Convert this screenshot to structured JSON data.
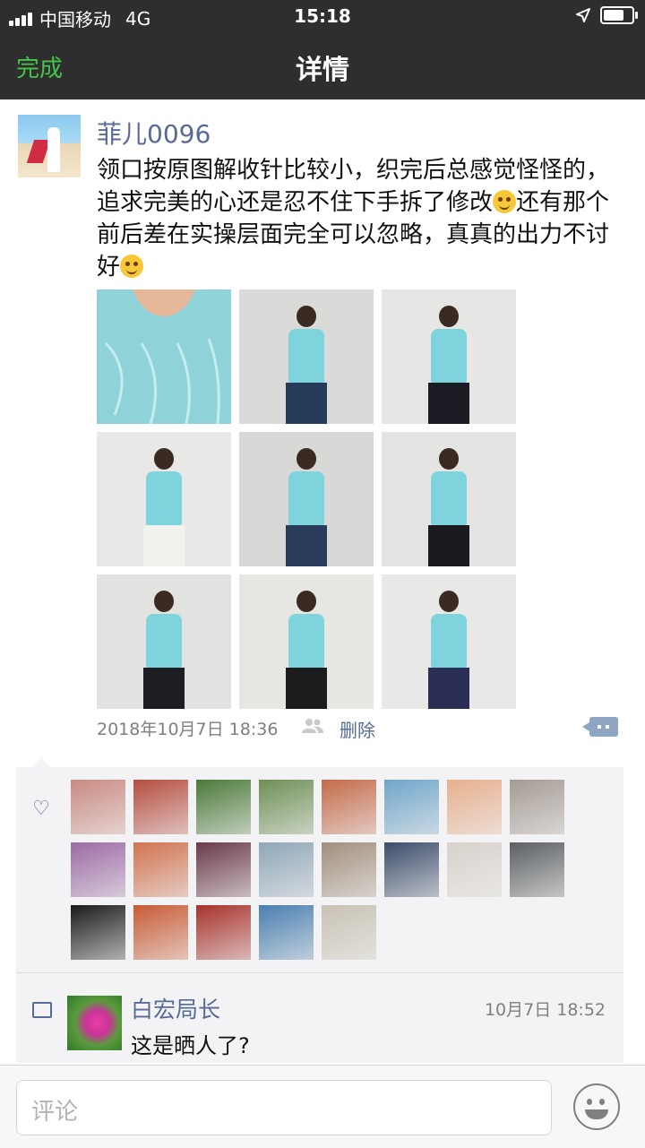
{
  "status_bar": {
    "carrier": "中国移动",
    "network": "4G",
    "time": "15:18",
    "battery_level": 0.85
  },
  "nav": {
    "back_label": "完成",
    "title": "详情"
  },
  "post": {
    "username": "菲儿0096",
    "text_part1": "领口按原图解收针比较小，织完后总感觉怪怪的，追求完美的心还是忍不住下手拆了修改",
    "text_part2": "还有那个前后差在实操层面完全可以忽略，真真的出力不讨好",
    "photos": [
      {
        "icon": "knit-closeup-photo"
      },
      {
        "icon": "overalls-photo"
      },
      {
        "icon": "polka-skirt-photo"
      },
      {
        "icon": "white-skirt-photo"
      },
      {
        "icon": "overalls-pose-photo"
      },
      {
        "icon": "polka-skirt-photo-2"
      },
      {
        "icon": "side-pose-photo"
      },
      {
        "icon": "front-pose-photo"
      },
      {
        "icon": "cardigan-photo"
      }
    ],
    "timestamp": "2018年10月7日 18:36",
    "delete_label": "删除"
  },
  "likes": {
    "count_shown": 21
  },
  "comments": [
    {
      "name": "白宏局长",
      "time": "10月7日 18:52",
      "text": "这是晒人了?"
    }
  ],
  "comment_bar": {
    "placeholder": "评论"
  },
  "colors": {
    "link": "#576b95",
    "accent_green": "#44c44a",
    "bar_bg": "#2e2e2e"
  }
}
